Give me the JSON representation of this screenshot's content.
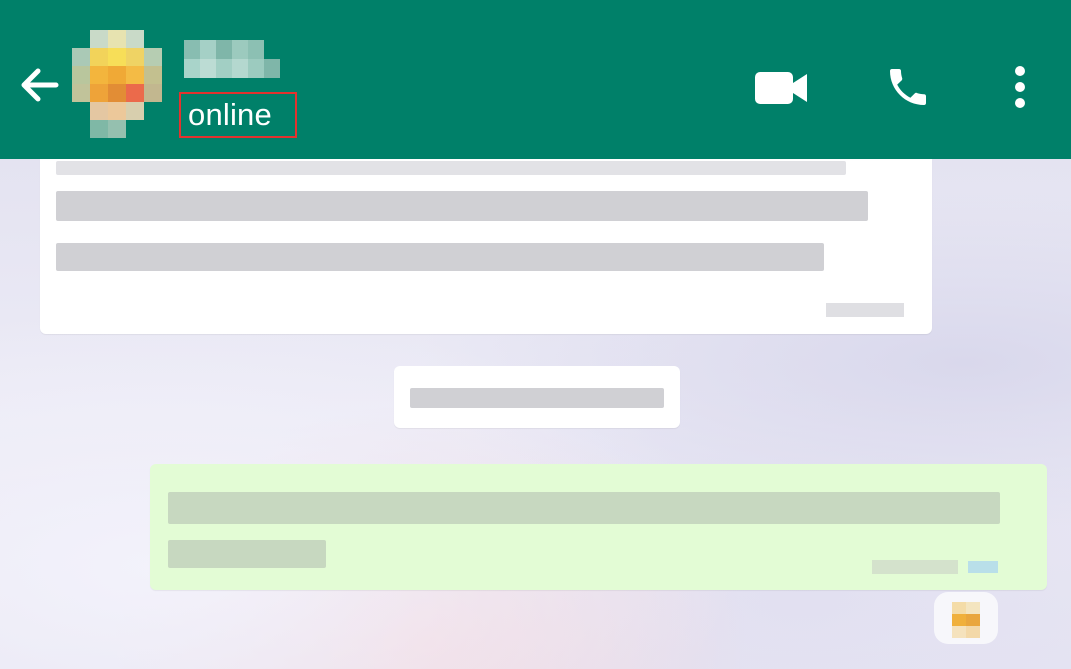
{
  "header": {
    "back_icon": "arrow-left-icon",
    "contact_name": "",
    "status": "online",
    "actions": [
      {
        "name": "video-call",
        "icon": "video-camera-icon"
      },
      {
        "name": "voice-call",
        "icon": "phone-icon"
      },
      {
        "name": "more-options",
        "icon": "kebab-menu-icon"
      }
    ],
    "background_color": "#008069",
    "highlight_color": "#e3322e"
  },
  "chat": {
    "incoming_message": {
      "text": "",
      "time": ""
    },
    "date_separator": "",
    "outgoing_message": {
      "text": "",
      "time": "",
      "read_status": "read"
    },
    "reaction_emoji": "reaction-emoji-icon",
    "incoming_bubble_color": "#ffffff",
    "outgoing_bubble_color": "#e3fcd5"
  }
}
